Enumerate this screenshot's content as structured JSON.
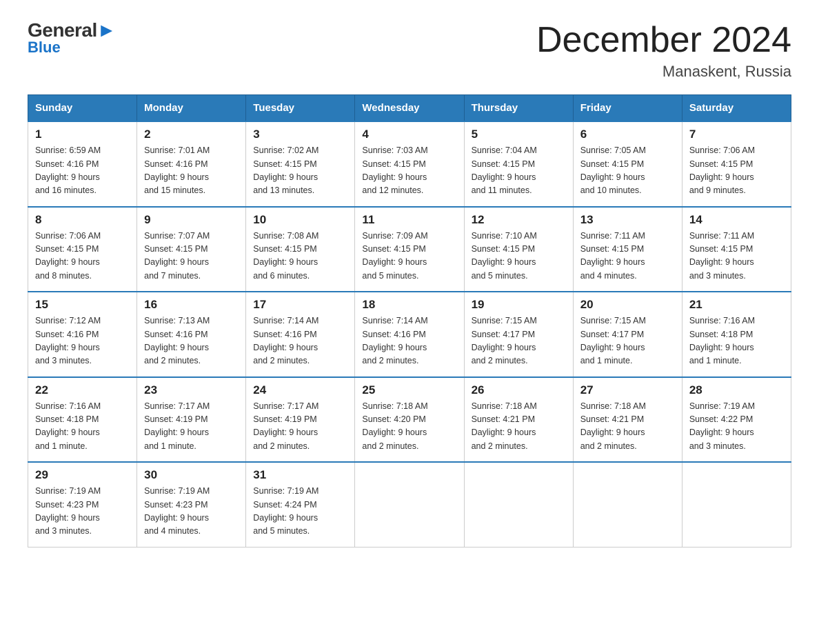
{
  "logo": {
    "part1": "General",
    "part2": "Blue"
  },
  "title": "December 2024",
  "subtitle": "Manaskent, Russia",
  "days_of_week": [
    "Sunday",
    "Monday",
    "Tuesday",
    "Wednesday",
    "Thursday",
    "Friday",
    "Saturday"
  ],
  "weeks": [
    [
      {
        "day": "1",
        "sunrise": "6:59 AM",
        "sunset": "4:16 PM",
        "daylight": "9 hours and 16 minutes."
      },
      {
        "day": "2",
        "sunrise": "7:01 AM",
        "sunset": "4:16 PM",
        "daylight": "9 hours and 15 minutes."
      },
      {
        "day": "3",
        "sunrise": "7:02 AM",
        "sunset": "4:15 PM",
        "daylight": "9 hours and 13 minutes."
      },
      {
        "day": "4",
        "sunrise": "7:03 AM",
        "sunset": "4:15 PM",
        "daylight": "9 hours and 12 minutes."
      },
      {
        "day": "5",
        "sunrise": "7:04 AM",
        "sunset": "4:15 PM",
        "daylight": "9 hours and 11 minutes."
      },
      {
        "day": "6",
        "sunrise": "7:05 AM",
        "sunset": "4:15 PM",
        "daylight": "9 hours and 10 minutes."
      },
      {
        "day": "7",
        "sunrise": "7:06 AM",
        "sunset": "4:15 PM",
        "daylight": "9 hours and 9 minutes."
      }
    ],
    [
      {
        "day": "8",
        "sunrise": "7:06 AM",
        "sunset": "4:15 PM",
        "daylight": "9 hours and 8 minutes."
      },
      {
        "day": "9",
        "sunrise": "7:07 AM",
        "sunset": "4:15 PM",
        "daylight": "9 hours and 7 minutes."
      },
      {
        "day": "10",
        "sunrise": "7:08 AM",
        "sunset": "4:15 PM",
        "daylight": "9 hours and 6 minutes."
      },
      {
        "day": "11",
        "sunrise": "7:09 AM",
        "sunset": "4:15 PM",
        "daylight": "9 hours and 5 minutes."
      },
      {
        "day": "12",
        "sunrise": "7:10 AM",
        "sunset": "4:15 PM",
        "daylight": "9 hours and 5 minutes."
      },
      {
        "day": "13",
        "sunrise": "7:11 AM",
        "sunset": "4:15 PM",
        "daylight": "9 hours and 4 minutes."
      },
      {
        "day": "14",
        "sunrise": "7:11 AM",
        "sunset": "4:15 PM",
        "daylight": "9 hours and 3 minutes."
      }
    ],
    [
      {
        "day": "15",
        "sunrise": "7:12 AM",
        "sunset": "4:16 PM",
        "daylight": "9 hours and 3 minutes."
      },
      {
        "day": "16",
        "sunrise": "7:13 AM",
        "sunset": "4:16 PM",
        "daylight": "9 hours and 2 minutes."
      },
      {
        "day": "17",
        "sunrise": "7:14 AM",
        "sunset": "4:16 PM",
        "daylight": "9 hours and 2 minutes."
      },
      {
        "day": "18",
        "sunrise": "7:14 AM",
        "sunset": "4:16 PM",
        "daylight": "9 hours and 2 minutes."
      },
      {
        "day": "19",
        "sunrise": "7:15 AM",
        "sunset": "4:17 PM",
        "daylight": "9 hours and 2 minutes."
      },
      {
        "day": "20",
        "sunrise": "7:15 AM",
        "sunset": "4:17 PM",
        "daylight": "9 hours and 1 minute."
      },
      {
        "day": "21",
        "sunrise": "7:16 AM",
        "sunset": "4:18 PM",
        "daylight": "9 hours and 1 minute."
      }
    ],
    [
      {
        "day": "22",
        "sunrise": "7:16 AM",
        "sunset": "4:18 PM",
        "daylight": "9 hours and 1 minute."
      },
      {
        "day": "23",
        "sunrise": "7:17 AM",
        "sunset": "4:19 PM",
        "daylight": "9 hours and 1 minute."
      },
      {
        "day": "24",
        "sunrise": "7:17 AM",
        "sunset": "4:19 PM",
        "daylight": "9 hours and 2 minutes."
      },
      {
        "day": "25",
        "sunrise": "7:18 AM",
        "sunset": "4:20 PM",
        "daylight": "9 hours and 2 minutes."
      },
      {
        "day": "26",
        "sunrise": "7:18 AM",
        "sunset": "4:21 PM",
        "daylight": "9 hours and 2 minutes."
      },
      {
        "day": "27",
        "sunrise": "7:18 AM",
        "sunset": "4:21 PM",
        "daylight": "9 hours and 2 minutes."
      },
      {
        "day": "28",
        "sunrise": "7:19 AM",
        "sunset": "4:22 PM",
        "daylight": "9 hours and 3 minutes."
      }
    ],
    [
      {
        "day": "29",
        "sunrise": "7:19 AM",
        "sunset": "4:23 PM",
        "daylight": "9 hours and 3 minutes."
      },
      {
        "day": "30",
        "sunrise": "7:19 AM",
        "sunset": "4:23 PM",
        "daylight": "9 hours and 4 minutes."
      },
      {
        "day": "31",
        "sunrise": "7:19 AM",
        "sunset": "4:24 PM",
        "daylight": "9 hours and 5 minutes."
      },
      null,
      null,
      null,
      null
    ]
  ]
}
